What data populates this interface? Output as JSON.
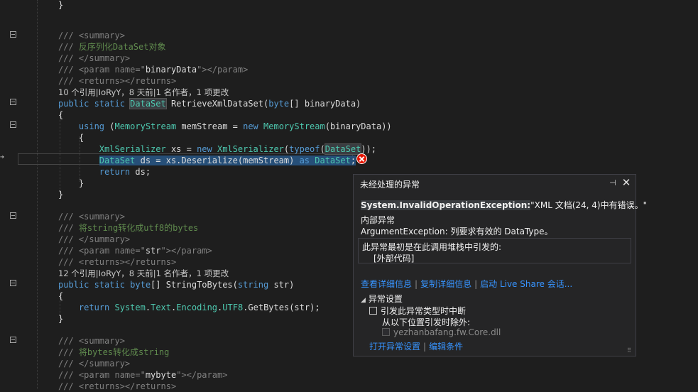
{
  "code_lines": [
    {
      "id": "l0",
      "parts": [
        {
          "c": "pn",
          "t": "}"
        }
      ]
    },
    {
      "id": "l1",
      "parts": [
        {
          "c": "xt",
          "t": "/// <summary>"
        }
      ]
    },
    {
      "id": "l2",
      "parts": [
        {
          "c": "xt",
          "t": "/// "
        },
        {
          "c": "xd",
          "t": "反序列化DataSet对象"
        }
      ]
    },
    {
      "id": "l3",
      "parts": [
        {
          "c": "xt",
          "t": "/// </summary>"
        }
      ]
    },
    {
      "id": "l4",
      "parts": [
        {
          "c": "xt",
          "t": "/// <param name=\""
        },
        {
          "c": "pn",
          "t": "binaryData"
        },
        {
          "c": "xt",
          "t": "\"></param>"
        }
      ]
    },
    {
      "id": "l5",
      "parts": [
        {
          "c": "xt",
          "t": "/// <returns></returns>"
        }
      ]
    },
    {
      "id": "l6",
      "parts": [
        {
          "c": "meta",
          "t": "10 个引用|IoRyY，8 天前|1 名作者，1 项更改"
        }
      ]
    },
    {
      "id": "l7",
      "parts": [
        {
          "c": "kw",
          "t": "public static "
        },
        {
          "c": "ty hl2",
          "t": "DataSet"
        },
        {
          "c": "pn",
          "t": " RetrieveXmlDataSet("
        },
        {
          "c": "kw",
          "t": "byte"
        },
        {
          "c": "pn",
          "t": "[] binaryData)"
        }
      ]
    },
    {
      "id": "l8",
      "parts": [
        {
          "c": "pn",
          "t": "{"
        }
      ]
    },
    {
      "id": "l9",
      "parts": [
        {
          "c": "pn",
          "t": "    "
        },
        {
          "c": "kw",
          "t": "using"
        },
        {
          "c": "pn",
          "t": " ("
        },
        {
          "c": "ty",
          "t": "MemoryStream"
        },
        {
          "c": "pn",
          "t": " memStream = "
        },
        {
          "c": "kw",
          "t": "new "
        },
        {
          "c": "ty",
          "t": "MemoryStream"
        },
        {
          "c": "pn",
          "t": "(binaryData))"
        }
      ]
    },
    {
      "id": "l10",
      "parts": [
        {
          "c": "pn",
          "t": "    {"
        }
      ]
    },
    {
      "id": "l11",
      "parts": [
        {
          "c": "pn",
          "t": "        "
        },
        {
          "c": "ty",
          "t": "XmlSerializer"
        },
        {
          "c": "pn",
          "t": " xs = "
        },
        {
          "c": "kw",
          "t": "new "
        },
        {
          "c": "ty",
          "t": "XmlSerializer"
        },
        {
          "c": "pn",
          "t": "("
        },
        {
          "c": "kw",
          "t": "typeof"
        },
        {
          "c": "pn",
          "t": "("
        },
        {
          "c": "ty hl2",
          "t": "DataSet"
        },
        {
          "c": "pn",
          "t": "));"
        }
      ]
    },
    {
      "id": "l12",
      "parts": [
        {
          "c": "pn",
          "t": "        "
        },
        {
          "c": "ty hl",
          "t": "DataSet"
        },
        {
          "c": "pn hl",
          "t": " ds = xs.Deserialize(memStream) "
        },
        {
          "c": "kw hl",
          "t": "as"
        },
        {
          "c": "pn hl",
          "t": " "
        },
        {
          "c": "ty hl",
          "t": "DataSet"
        },
        {
          "c": "pn hl",
          "t": ";"
        }
      ]
    },
    {
      "id": "l13",
      "parts": [
        {
          "c": "pn",
          "t": "        "
        },
        {
          "c": "kw",
          "t": "return"
        },
        {
          "c": "pn",
          "t": " ds;"
        }
      ]
    },
    {
      "id": "l14",
      "parts": [
        {
          "c": "pn",
          "t": "    }"
        }
      ]
    },
    {
      "id": "l15",
      "parts": [
        {
          "c": "pn",
          "t": "}"
        }
      ]
    },
    {
      "id": "l16",
      "parts": [
        {
          "c": "xt",
          "t": "/// <summary>"
        }
      ]
    },
    {
      "id": "l17",
      "parts": [
        {
          "c": "xt",
          "t": "/// "
        },
        {
          "c": "xd",
          "t": "将string转化成utf8的bytes"
        }
      ]
    },
    {
      "id": "l18",
      "parts": [
        {
          "c": "xt",
          "t": "/// </summary>"
        }
      ]
    },
    {
      "id": "l19",
      "parts": [
        {
          "c": "xt",
          "t": "/// <param name=\""
        },
        {
          "c": "pn",
          "t": "str"
        },
        {
          "c": "xt",
          "t": "\"></param>"
        }
      ]
    },
    {
      "id": "l20",
      "parts": [
        {
          "c": "xt",
          "t": "/// <returns></returns>"
        }
      ]
    },
    {
      "id": "l21",
      "parts": [
        {
          "c": "meta",
          "t": "12 个引用|IoRyY，8 天前|1 名作者，1 项更改"
        }
      ]
    },
    {
      "id": "l22",
      "parts": [
        {
          "c": "kw",
          "t": "public static byte"
        },
        {
          "c": "pn",
          "t": "[] StringToBytes("
        },
        {
          "c": "kw",
          "t": "string"
        },
        {
          "c": "pn",
          "t": " str)"
        }
      ]
    },
    {
      "id": "l23",
      "parts": [
        {
          "c": "pn",
          "t": "{"
        }
      ]
    },
    {
      "id": "l24",
      "parts": [
        {
          "c": "pn",
          "t": "    "
        },
        {
          "c": "kw",
          "t": "return"
        },
        {
          "c": "pn",
          "t": " "
        },
        {
          "c": "ty",
          "t": "System"
        },
        {
          "c": "pn",
          "t": "."
        },
        {
          "c": "ty",
          "t": "Text"
        },
        {
          "c": "pn",
          "t": "."
        },
        {
          "c": "ty",
          "t": "Encoding"
        },
        {
          "c": "pn",
          "t": "."
        },
        {
          "c": "ty",
          "t": "UTF8"
        },
        {
          "c": "pn",
          "t": ".GetBytes(str);"
        }
      ]
    },
    {
      "id": "l25",
      "parts": [
        {
          "c": "pn",
          "t": "}"
        }
      ]
    },
    {
      "id": "l26",
      "parts": [
        {
          "c": "xt",
          "t": "/// <summary>"
        }
      ]
    },
    {
      "id": "l27",
      "parts": [
        {
          "c": "xt",
          "t": "/// "
        },
        {
          "c": "xd",
          "t": "将bytes转化成string"
        }
      ]
    },
    {
      "id": "l28",
      "parts": [
        {
          "c": "xt",
          "t": "/// </summary>"
        }
      ]
    },
    {
      "id": "l29",
      "parts": [
        {
          "c": "xt",
          "t": "/// <param name=\""
        },
        {
          "c": "pn",
          "t": "mybyte"
        },
        {
          "c": "xt",
          "t": "\"></param>"
        }
      ]
    },
    {
      "id": "l30",
      "parts": [
        {
          "c": "xt",
          "t": "/// <returns></returns>"
        }
      ]
    }
  ],
  "exception_popup": {
    "title": "未经处理的异常",
    "pin_icon": "pin-icon",
    "close_icon": "close-icon",
    "exception_type": "System.InvalidOperationException:",
    "exception_message": "\"XML 文档(24, 4)中有错误。\"",
    "inner_title": "内部异常",
    "inner_message": "ArgumentException: 列要求有效的 DataType。",
    "stack_title": "此异常最初是在此调用堆栈中引发的:",
    "stack_item": "[外部代码]",
    "link_view_details": "查看详细信息",
    "link_copy_details": "复制详细信息",
    "link_live_share": "启动 Live Share 会话...",
    "settings_title": "异常设置",
    "break_when_thrown": "引发此异常类型时中断",
    "except_when_from": "从以下位置引发时除外:",
    "module_name": "yezhanbafang.fw.Core.dll",
    "link_open_settings": "打开异常设置",
    "link_edit_conditions": "编辑条件"
  },
  "colors": {
    "background": "#1e1e1e",
    "keyword": "#569cd6",
    "type": "#4ec9b0",
    "comment": "#57a64a",
    "error": "#e51400",
    "link": "#3794ff"
  }
}
